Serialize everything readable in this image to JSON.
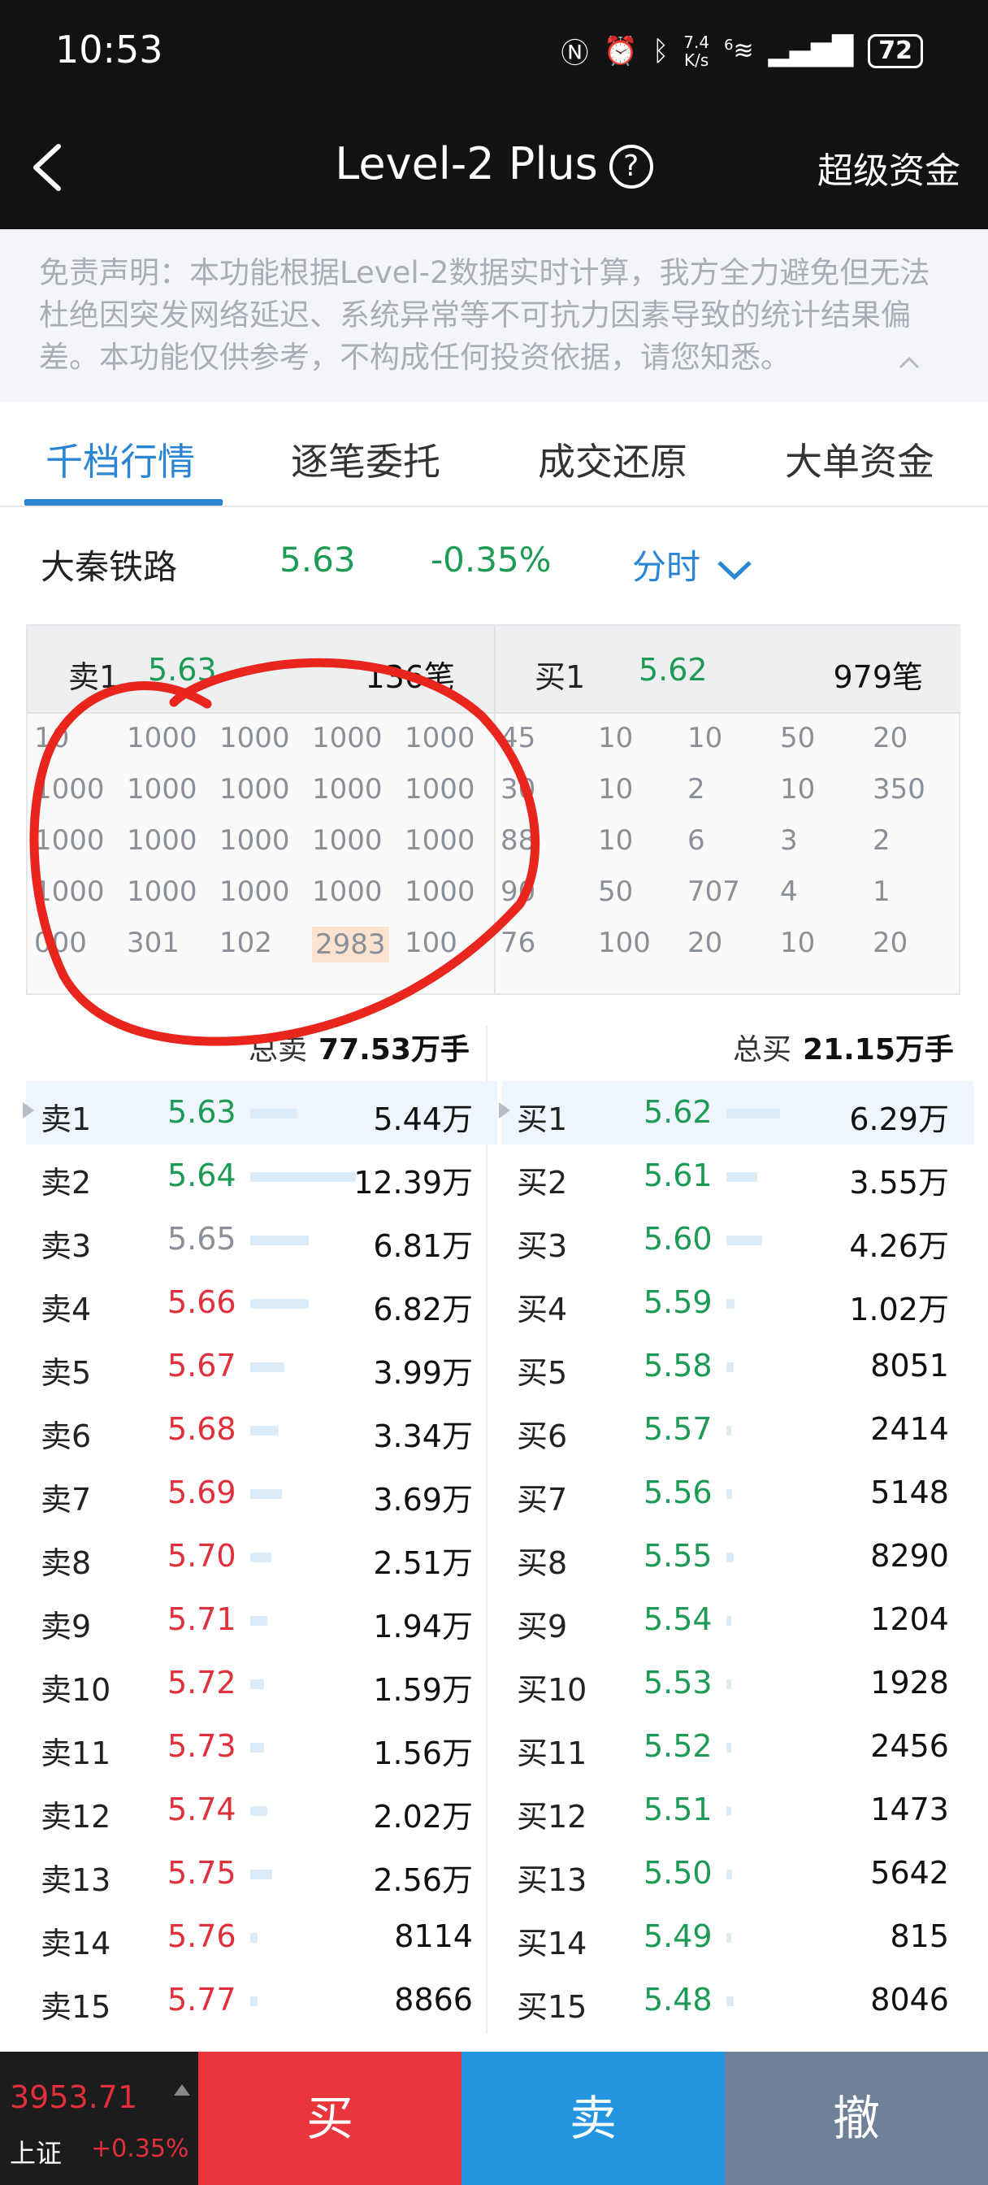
{
  "status": {
    "time": "10:53",
    "speed_top": "7.4",
    "speed_bottom": "K/s",
    "signal_label": "6",
    "battery": "72"
  },
  "nav": {
    "title": "Level-2 Plus",
    "help": "?",
    "right": "超级资金"
  },
  "disclaimer": "免责声明：本功能根据Level-2数据实时计算，我方全力避免但无法杜绝因突发网络延迟、系统异常等不可抗力因素导致的统计结果偏差。本功能仅供参考，不构成任何投资依据，请您知悉。",
  "tabs": [
    "千档行情",
    "逐笔委托",
    "成交还原",
    "大单资金"
  ],
  "quote": {
    "name": "大秦铁路",
    "price": "5.63",
    "change": "-0.35%",
    "period": "分时"
  },
  "queue": {
    "sell": {
      "label": "卖1",
      "price": "5.63",
      "count": "136笔",
      "rows": [
        [
          "10",
          "1000",
          "1000",
          "1000",
          "1000"
        ],
        [
          "1000",
          "1000",
          "1000",
          "1000",
          "1000"
        ],
        [
          "1000",
          "1000",
          "1000",
          "1000",
          "1000"
        ],
        [
          "1000",
          "1000",
          "1000",
          "1000",
          "1000"
        ],
        [
          "000",
          "301",
          "102",
          "2983",
          "100"
        ]
      ]
    },
    "buy": {
      "label": "买1",
      "price": "5.62",
      "count": "979笔",
      "rows": [
        [
          "45",
          "10",
          "10",
          "50",
          "20"
        ],
        [
          "30",
          "10",
          "2",
          "10",
          "350"
        ],
        [
          "88",
          "10",
          "6",
          "3",
          "2"
        ],
        [
          "90",
          "50",
          "707",
          "4",
          "1"
        ],
        [
          "76",
          "100",
          "20",
          "10",
          "20"
        ]
      ]
    }
  },
  "totals": {
    "sell_label": "总卖",
    "sell_value": "77.53万手",
    "buy_label": "总买",
    "buy_value": "21.15万手"
  },
  "sell_levels": [
    {
      "label": "卖1",
      "price": "5.63",
      "volume": "5.44万",
      "bar": 0.44,
      "color": "green"
    },
    {
      "label": "卖2",
      "price": "5.64",
      "volume": "12.39万",
      "bar": 1.0,
      "color": "green"
    },
    {
      "label": "卖3",
      "price": "5.65",
      "volume": "6.81万",
      "bar": 0.55,
      "color": "gray"
    },
    {
      "label": "卖4",
      "price": "5.66",
      "volume": "6.82万",
      "bar": 0.55,
      "color": "red"
    },
    {
      "label": "卖5",
      "price": "5.67",
      "volume": "3.99万",
      "bar": 0.32,
      "color": "red"
    },
    {
      "label": "卖6",
      "price": "5.68",
      "volume": "3.34万",
      "bar": 0.27,
      "color": "red"
    },
    {
      "label": "卖7",
      "price": "5.69",
      "volume": "3.69万",
      "bar": 0.3,
      "color": "red"
    },
    {
      "label": "卖8",
      "price": "5.70",
      "volume": "2.51万",
      "bar": 0.2,
      "color": "red"
    },
    {
      "label": "卖9",
      "price": "5.71",
      "volume": "1.94万",
      "bar": 0.16,
      "color": "red"
    },
    {
      "label": "卖10",
      "price": "5.72",
      "volume": "1.59万",
      "bar": 0.13,
      "color": "red"
    },
    {
      "label": "卖11",
      "price": "5.73",
      "volume": "1.56万",
      "bar": 0.13,
      "color": "red"
    },
    {
      "label": "卖12",
      "price": "5.74",
      "volume": "2.02万",
      "bar": 0.16,
      "color": "red"
    },
    {
      "label": "卖13",
      "price": "5.75",
      "volume": "2.56万",
      "bar": 0.21,
      "color": "red"
    },
    {
      "label": "卖14",
      "price": "5.76",
      "volume": "8114",
      "bar": 0.07,
      "color": "red"
    },
    {
      "label": "卖15",
      "price": "5.77",
      "volume": "8866",
      "bar": 0.07,
      "color": "red"
    }
  ],
  "buy_levels": [
    {
      "label": "买1",
      "price": "5.62",
      "volume": "6.29万",
      "bar": 0.51,
      "color": "green"
    },
    {
      "label": "买2",
      "price": "5.61",
      "volume": "3.55万",
      "bar": 0.29,
      "color": "green"
    },
    {
      "label": "买3",
      "price": "5.60",
      "volume": "4.26万",
      "bar": 0.34,
      "color": "green"
    },
    {
      "label": "买4",
      "price": "5.59",
      "volume": "1.02万",
      "bar": 0.08,
      "color": "green"
    },
    {
      "label": "买5",
      "price": "5.58",
      "volume": "8051",
      "bar": 0.07,
      "color": "green"
    },
    {
      "label": "买6",
      "price": "5.57",
      "volume": "2414",
      "bar": 0.03,
      "color": "green"
    },
    {
      "label": "买7",
      "price": "5.56",
      "volume": "5148",
      "bar": 0.05,
      "color": "green"
    },
    {
      "label": "买8",
      "price": "5.55",
      "volume": "8290",
      "bar": 0.07,
      "color": "green"
    },
    {
      "label": "买9",
      "price": "5.54",
      "volume": "1204",
      "bar": 0.02,
      "color": "green"
    },
    {
      "label": "买10",
      "price": "5.53",
      "volume": "1928",
      "bar": 0.02,
      "color": "green"
    },
    {
      "label": "买11",
      "price": "5.52",
      "volume": "2456",
      "bar": 0.03,
      "color": "green"
    },
    {
      "label": "买12",
      "price": "5.51",
      "volume": "1473",
      "bar": 0.02,
      "color": "green"
    },
    {
      "label": "买13",
      "price": "5.50",
      "volume": "5642",
      "bar": 0.05,
      "color": "green"
    },
    {
      "label": "买14",
      "price": "5.49",
      "volume": "815",
      "bar": 0.02,
      "color": "green"
    },
    {
      "label": "买15",
      "price": "5.48",
      "volume": "8046",
      "bar": 0.07,
      "color": "green"
    }
  ],
  "index": {
    "value": "3953.71",
    "name": "上证",
    "change": "+0.35%"
  },
  "actions": {
    "buy": "买",
    "sell": "卖",
    "cancel": "撤"
  },
  "colors": {
    "green": "#1d9a55",
    "red": "#e0303b",
    "gray": "#8a8f98",
    "accent": "#2a86d5",
    "annotation": "#e8261e"
  }
}
